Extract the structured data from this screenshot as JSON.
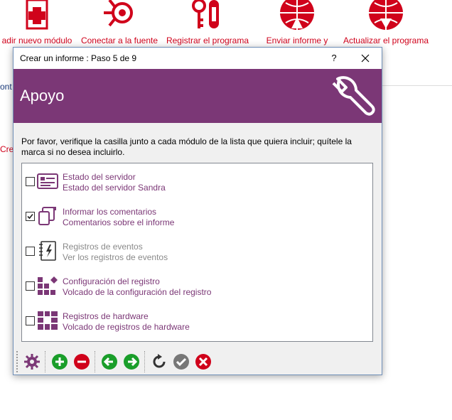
{
  "ribbon": {
    "items": [
      {
        "label": "adir nuevo módulo",
        "icon": "first-aid-kit-icon"
      },
      {
        "label": "Conectar a la fuente",
        "icon": "connect-icon"
      },
      {
        "label": "Registrar el programa",
        "icon": "register-key-icon"
      },
      {
        "label": "Enviar informe y",
        "icon": "send-globe-icon"
      },
      {
        "label": "Actualizar el programa",
        "icon": "update-globe-icon"
      }
    ]
  },
  "background": {
    "frag_cont": "ont",
    "frag_crea": "Crea"
  },
  "dialog": {
    "title": "Crear un informe : Paso 5 de 9",
    "help_label": "?",
    "banner_title": "Apoyo",
    "banner_icon": "wrench-icon",
    "instructions": "Por favor, verifique la casilla junto a cada módulo de la lista que quiera incluir; quítele la marca si no desea incluirlo.",
    "modules": [
      {
        "title": "Estado del servidor",
        "desc": "Estado del servidor Sandra",
        "checked": false,
        "enabled": true,
        "icon": "server-status-icon"
      },
      {
        "title": "Informar los comentarios",
        "desc": "Comentarios sobre el informe",
        "checked": true,
        "enabled": true,
        "icon": "report-comments-icon"
      },
      {
        "title": "Registros de eventos",
        "desc": "Ver los registros de eventos",
        "checked": false,
        "enabled": false,
        "icon": "event-log-icon"
      },
      {
        "title": "Configuración del registro",
        "desc": "Volcado de la configuración del registro",
        "checked": false,
        "enabled": true,
        "icon": "registry-config-icon"
      },
      {
        "title": "Registros de hardware",
        "desc": "Volcado de registros de hardware",
        "checked": false,
        "enabled": true,
        "icon": "hardware-registers-icon"
      }
    ],
    "toolbar": [
      "settings-gear-icon",
      "add-icon",
      "remove-icon",
      "back-icon",
      "next-icon",
      "refresh-icon",
      "ok-check-icon",
      "cancel-icon"
    ]
  },
  "colors": {
    "accent": "#7b3776",
    "brand_red": "#d0021b",
    "green": "#1a9e2a"
  }
}
